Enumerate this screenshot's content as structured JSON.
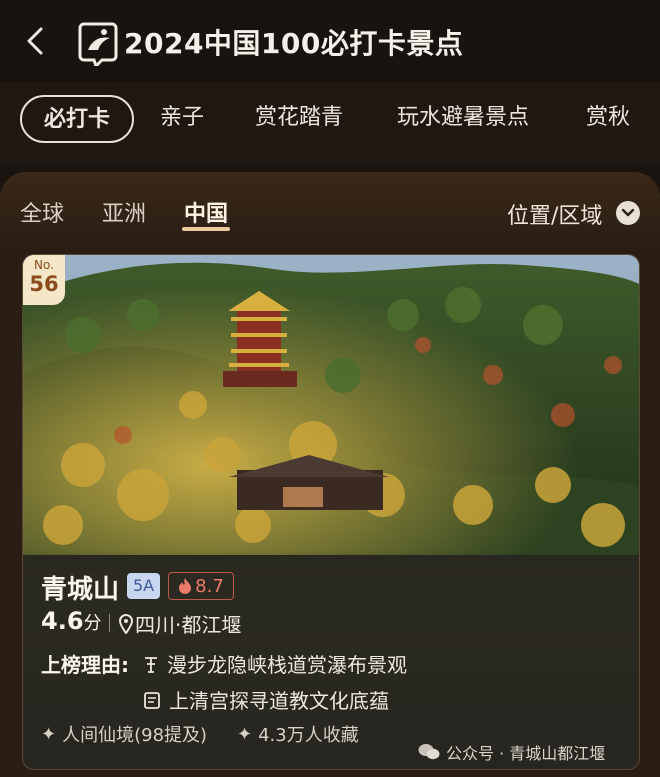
{
  "header": {
    "title": "2024中国100必打卡景点"
  },
  "tabs": [
    {
      "label": "必打卡"
    },
    {
      "label": "亲子"
    },
    {
      "label": "赏花踏青"
    },
    {
      "label": "玩水避暑景点"
    },
    {
      "label": "赏秋"
    }
  ],
  "subtabs": [
    {
      "label": "全球"
    },
    {
      "label": "亚洲"
    },
    {
      "label": "中国"
    }
  ],
  "region_filter": {
    "label": "位置/区域"
  },
  "card": {
    "rank_prefix": "No.",
    "rank": "56",
    "name": "青城山",
    "level_badge": "5A",
    "heat": "8.7",
    "score": "4.6",
    "score_unit": "分",
    "location": "四川·都江堰",
    "reason_label": "上榜理由:",
    "reasons": [
      {
        "text": "漫步龙隐峡栈道赏瀑布景观",
        "icon": "path-icon"
      },
      {
        "text": "上清宫探寻道教文化底蕴",
        "icon": "temple-icon"
      }
    ],
    "tags": [
      {
        "text": "人间仙境(98提及)"
      },
      {
        "text": "4.3万人收藏"
      }
    ]
  },
  "watermark": {
    "text": "公众号 · 青城山都江堰"
  },
  "colors": {
    "accent": "#f0c89c",
    "heat": "#ec7a68",
    "badge": "#c9d6ef"
  }
}
